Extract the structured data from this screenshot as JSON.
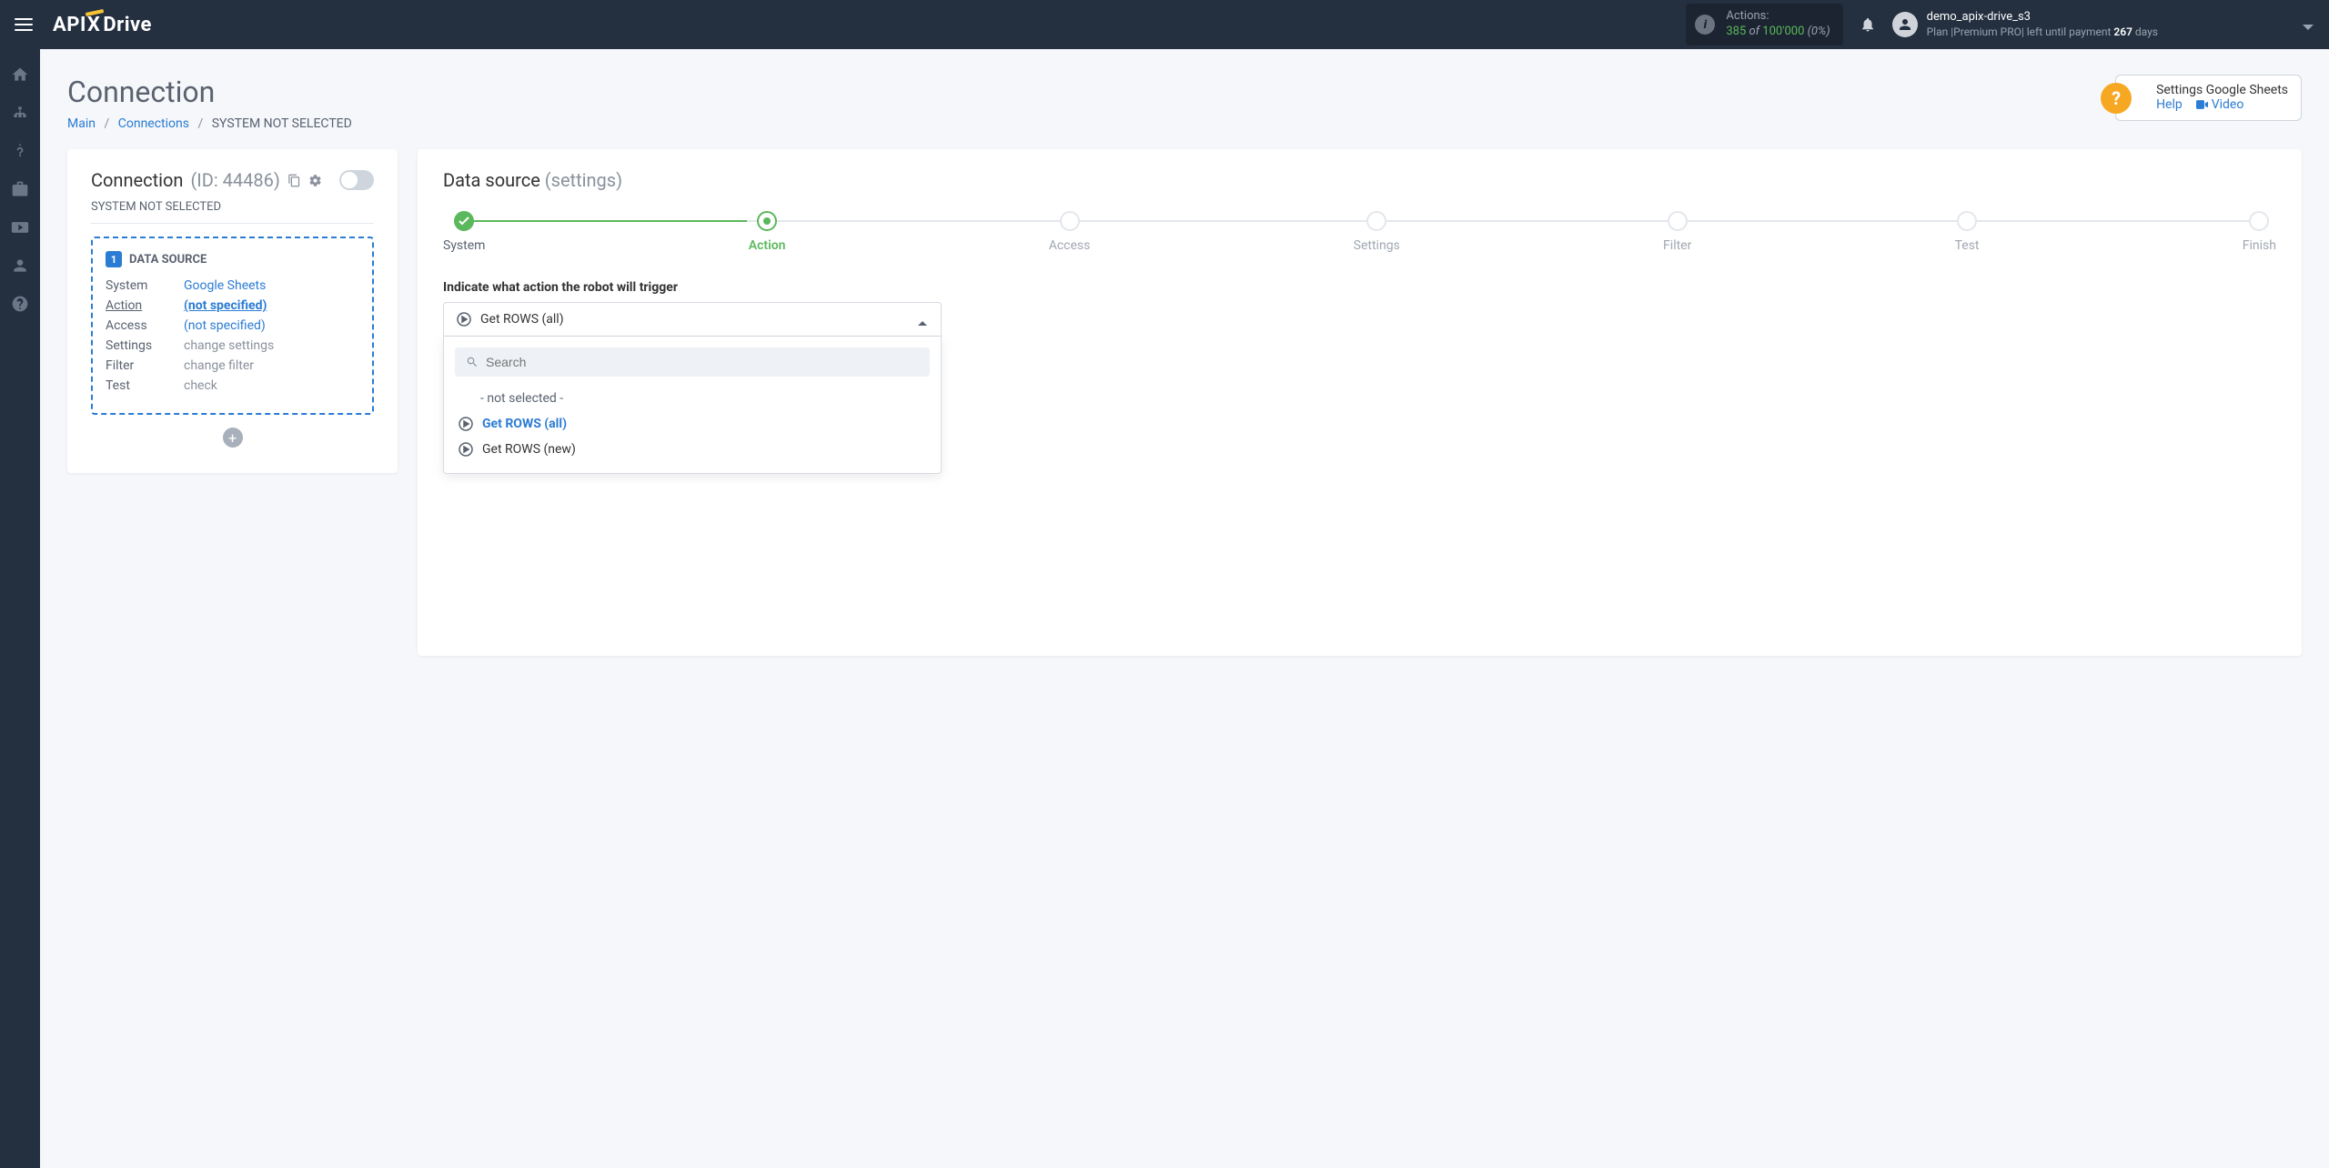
{
  "header": {
    "logo_api": "API",
    "logo_x": "X",
    "logo_drive": "Drive",
    "actions_label": "Actions:",
    "actions_val": "385",
    "actions_of": " of ",
    "actions_total": "100'000",
    "actions_pct": " (0%)",
    "user_name": "demo_apix-drive_s3",
    "plan_prefix": "Plan |",
    "plan_name": "Premium PRO",
    "plan_mid": "| left until payment ",
    "plan_days": "267",
    "plan_suffix": " days"
  },
  "page": {
    "title": "Connection",
    "breadcrumb_main": "Main",
    "breadcrumb_connections": "Connections",
    "breadcrumb_current": "SYSTEM NOT SELECTED"
  },
  "help": {
    "title": "Settings Google Sheets",
    "help_label": "Help",
    "video_label": "Video"
  },
  "left": {
    "conn_label": "Connection ",
    "conn_id": "(ID: 44486)",
    "sys_not_selected": "SYSTEM NOT SELECTED",
    "ds_badge": "1",
    "ds_title": "DATA SOURCE",
    "rows": {
      "system_k": "System",
      "system_v": "Google Sheets",
      "action_k": "Action",
      "action_v": "(not specified)",
      "access_k": "Access",
      "access_v": "(not specified)",
      "settings_k": "Settings",
      "settings_v": "change settings",
      "filter_k": "Filter",
      "filter_v": "change filter",
      "test_k": "Test",
      "test_v": "check"
    }
  },
  "right": {
    "title_main": "Data source ",
    "title_sub": "(settings)",
    "steps": [
      "System",
      "Action",
      "Access",
      "Settings",
      "Filter",
      "Test",
      "Finish"
    ],
    "prompt": "Indicate what action the robot will trigger",
    "selected": "Get ROWS (all)",
    "search_placeholder": "Search",
    "opt_none": "- not selected -",
    "opt1": "Get ROWS (all)",
    "opt2": "Get ROWS (new)"
  }
}
